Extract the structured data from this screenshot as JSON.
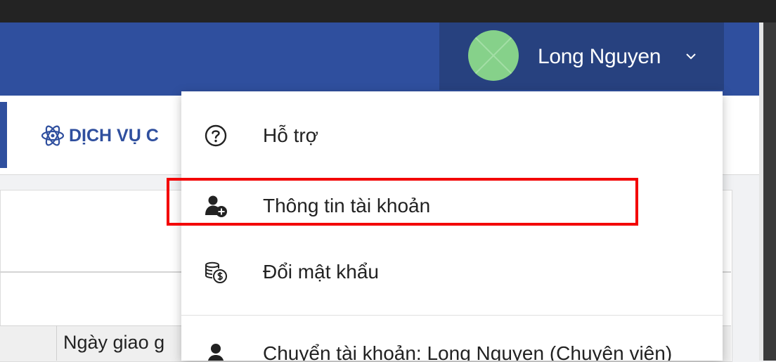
{
  "header": {
    "user_name": "Long Nguyen",
    "accent_color": "#2f4f9e"
  },
  "nav": {
    "service_label": "DỊCH VỤ C"
  },
  "table": {
    "column_date_label": "Ngày giao g"
  },
  "user_menu": {
    "items": [
      {
        "label": "Hỗ trợ",
        "icon": "question-circle-icon"
      },
      {
        "label": "Thông tin tài khoản",
        "icon": "user-plus-icon",
        "highlighted": true
      },
      {
        "label": "Đổi mật khẩu",
        "icon": "coins-icon"
      },
      {
        "label": "Chuyển tài khoản: Long Nguyen (Chuyên viên)",
        "icon": "user-icon"
      }
    ]
  }
}
